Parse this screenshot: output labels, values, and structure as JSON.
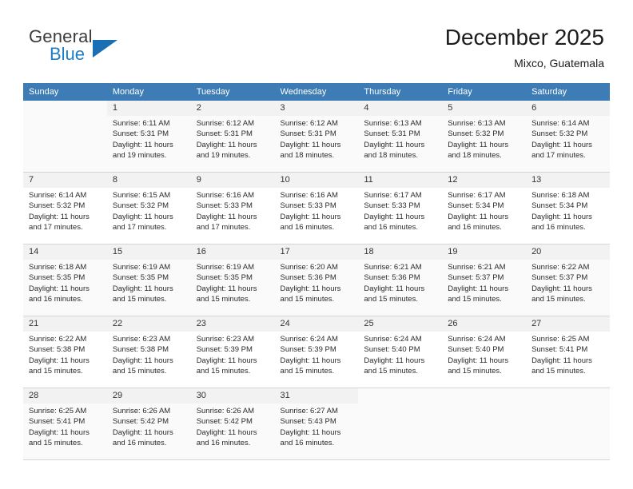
{
  "brand": {
    "name_top": "General",
    "name_bottom": "Blue",
    "accent_color": "#1a6fb5"
  },
  "header": {
    "title": "December 2025",
    "subtitle": "Mixco, Guatemala"
  },
  "calendar": {
    "header_bg": "#3d7cb5",
    "daynum_bg": "#f2f2f2",
    "weekday_headers": [
      "Sunday",
      "Monday",
      "Tuesday",
      "Wednesday",
      "Thursday",
      "Friday",
      "Saturday"
    ],
    "labels": {
      "sunrise_prefix": "Sunrise: ",
      "sunset_prefix": "Sunset: ",
      "daylight_prefix": "Daylight: "
    },
    "weeks": [
      [
        {
          "day": "",
          "sunrise": "",
          "sunset": "",
          "daylight_line1": "",
          "daylight_line2": ""
        },
        {
          "day": "1",
          "sunrise": "Sunrise: 6:11 AM",
          "sunset": "Sunset: 5:31 PM",
          "daylight_line1": "Daylight: 11 hours",
          "daylight_line2": "and 19 minutes."
        },
        {
          "day": "2",
          "sunrise": "Sunrise: 6:12 AM",
          "sunset": "Sunset: 5:31 PM",
          "daylight_line1": "Daylight: 11 hours",
          "daylight_line2": "and 19 minutes."
        },
        {
          "day": "3",
          "sunrise": "Sunrise: 6:12 AM",
          "sunset": "Sunset: 5:31 PM",
          "daylight_line1": "Daylight: 11 hours",
          "daylight_line2": "and 18 minutes."
        },
        {
          "day": "4",
          "sunrise": "Sunrise: 6:13 AM",
          "sunset": "Sunset: 5:31 PM",
          "daylight_line1": "Daylight: 11 hours",
          "daylight_line2": "and 18 minutes."
        },
        {
          "day": "5",
          "sunrise": "Sunrise: 6:13 AM",
          "sunset": "Sunset: 5:32 PM",
          "daylight_line1": "Daylight: 11 hours",
          "daylight_line2": "and 18 minutes."
        },
        {
          "day": "6",
          "sunrise": "Sunrise: 6:14 AM",
          "sunset": "Sunset: 5:32 PM",
          "daylight_line1": "Daylight: 11 hours",
          "daylight_line2": "and 17 minutes."
        }
      ],
      [
        {
          "day": "7",
          "sunrise": "Sunrise: 6:14 AM",
          "sunset": "Sunset: 5:32 PM",
          "daylight_line1": "Daylight: 11 hours",
          "daylight_line2": "and 17 minutes."
        },
        {
          "day": "8",
          "sunrise": "Sunrise: 6:15 AM",
          "sunset": "Sunset: 5:32 PM",
          "daylight_line1": "Daylight: 11 hours",
          "daylight_line2": "and 17 minutes."
        },
        {
          "day": "9",
          "sunrise": "Sunrise: 6:16 AM",
          "sunset": "Sunset: 5:33 PM",
          "daylight_line1": "Daylight: 11 hours",
          "daylight_line2": "and 17 minutes."
        },
        {
          "day": "10",
          "sunrise": "Sunrise: 6:16 AM",
          "sunset": "Sunset: 5:33 PM",
          "daylight_line1": "Daylight: 11 hours",
          "daylight_line2": "and 16 minutes."
        },
        {
          "day": "11",
          "sunrise": "Sunrise: 6:17 AM",
          "sunset": "Sunset: 5:33 PM",
          "daylight_line1": "Daylight: 11 hours",
          "daylight_line2": "and 16 minutes."
        },
        {
          "day": "12",
          "sunrise": "Sunrise: 6:17 AM",
          "sunset": "Sunset: 5:34 PM",
          "daylight_line1": "Daylight: 11 hours",
          "daylight_line2": "and 16 minutes."
        },
        {
          "day": "13",
          "sunrise": "Sunrise: 6:18 AM",
          "sunset": "Sunset: 5:34 PM",
          "daylight_line1": "Daylight: 11 hours",
          "daylight_line2": "and 16 minutes."
        }
      ],
      [
        {
          "day": "14",
          "sunrise": "Sunrise: 6:18 AM",
          "sunset": "Sunset: 5:35 PM",
          "daylight_line1": "Daylight: 11 hours",
          "daylight_line2": "and 16 minutes."
        },
        {
          "day": "15",
          "sunrise": "Sunrise: 6:19 AM",
          "sunset": "Sunset: 5:35 PM",
          "daylight_line1": "Daylight: 11 hours",
          "daylight_line2": "and 15 minutes."
        },
        {
          "day": "16",
          "sunrise": "Sunrise: 6:19 AM",
          "sunset": "Sunset: 5:35 PM",
          "daylight_line1": "Daylight: 11 hours",
          "daylight_line2": "and 15 minutes."
        },
        {
          "day": "17",
          "sunrise": "Sunrise: 6:20 AM",
          "sunset": "Sunset: 5:36 PM",
          "daylight_line1": "Daylight: 11 hours",
          "daylight_line2": "and 15 minutes."
        },
        {
          "day": "18",
          "sunrise": "Sunrise: 6:21 AM",
          "sunset": "Sunset: 5:36 PM",
          "daylight_line1": "Daylight: 11 hours",
          "daylight_line2": "and 15 minutes."
        },
        {
          "day": "19",
          "sunrise": "Sunrise: 6:21 AM",
          "sunset": "Sunset: 5:37 PM",
          "daylight_line1": "Daylight: 11 hours",
          "daylight_line2": "and 15 minutes."
        },
        {
          "day": "20",
          "sunrise": "Sunrise: 6:22 AM",
          "sunset": "Sunset: 5:37 PM",
          "daylight_line1": "Daylight: 11 hours",
          "daylight_line2": "and 15 minutes."
        }
      ],
      [
        {
          "day": "21",
          "sunrise": "Sunrise: 6:22 AM",
          "sunset": "Sunset: 5:38 PM",
          "daylight_line1": "Daylight: 11 hours",
          "daylight_line2": "and 15 minutes."
        },
        {
          "day": "22",
          "sunrise": "Sunrise: 6:23 AM",
          "sunset": "Sunset: 5:38 PM",
          "daylight_line1": "Daylight: 11 hours",
          "daylight_line2": "and 15 minutes."
        },
        {
          "day": "23",
          "sunrise": "Sunrise: 6:23 AM",
          "sunset": "Sunset: 5:39 PM",
          "daylight_line1": "Daylight: 11 hours",
          "daylight_line2": "and 15 minutes."
        },
        {
          "day": "24",
          "sunrise": "Sunrise: 6:24 AM",
          "sunset": "Sunset: 5:39 PM",
          "daylight_line1": "Daylight: 11 hours",
          "daylight_line2": "and 15 minutes."
        },
        {
          "day": "25",
          "sunrise": "Sunrise: 6:24 AM",
          "sunset": "Sunset: 5:40 PM",
          "daylight_line1": "Daylight: 11 hours",
          "daylight_line2": "and 15 minutes."
        },
        {
          "day": "26",
          "sunrise": "Sunrise: 6:24 AM",
          "sunset": "Sunset: 5:40 PM",
          "daylight_line1": "Daylight: 11 hours",
          "daylight_line2": "and 15 minutes."
        },
        {
          "day": "27",
          "sunrise": "Sunrise: 6:25 AM",
          "sunset": "Sunset: 5:41 PM",
          "daylight_line1": "Daylight: 11 hours",
          "daylight_line2": "and 15 minutes."
        }
      ],
      [
        {
          "day": "28",
          "sunrise": "Sunrise: 6:25 AM",
          "sunset": "Sunset: 5:41 PM",
          "daylight_line1": "Daylight: 11 hours",
          "daylight_line2": "and 15 minutes."
        },
        {
          "day": "29",
          "sunrise": "Sunrise: 6:26 AM",
          "sunset": "Sunset: 5:42 PM",
          "daylight_line1": "Daylight: 11 hours",
          "daylight_line2": "and 16 minutes."
        },
        {
          "day": "30",
          "sunrise": "Sunrise: 6:26 AM",
          "sunset": "Sunset: 5:42 PM",
          "daylight_line1": "Daylight: 11 hours",
          "daylight_line2": "and 16 minutes."
        },
        {
          "day": "31",
          "sunrise": "Sunrise: 6:27 AM",
          "sunset": "Sunset: 5:43 PM",
          "daylight_line1": "Daylight: 11 hours",
          "daylight_line2": "and 16 minutes."
        },
        {
          "day": "",
          "sunrise": "",
          "sunset": "",
          "daylight_line1": "",
          "daylight_line2": ""
        },
        {
          "day": "",
          "sunrise": "",
          "sunset": "",
          "daylight_line1": "",
          "daylight_line2": ""
        },
        {
          "day": "",
          "sunrise": "",
          "sunset": "",
          "daylight_line1": "",
          "daylight_line2": ""
        }
      ]
    ]
  }
}
